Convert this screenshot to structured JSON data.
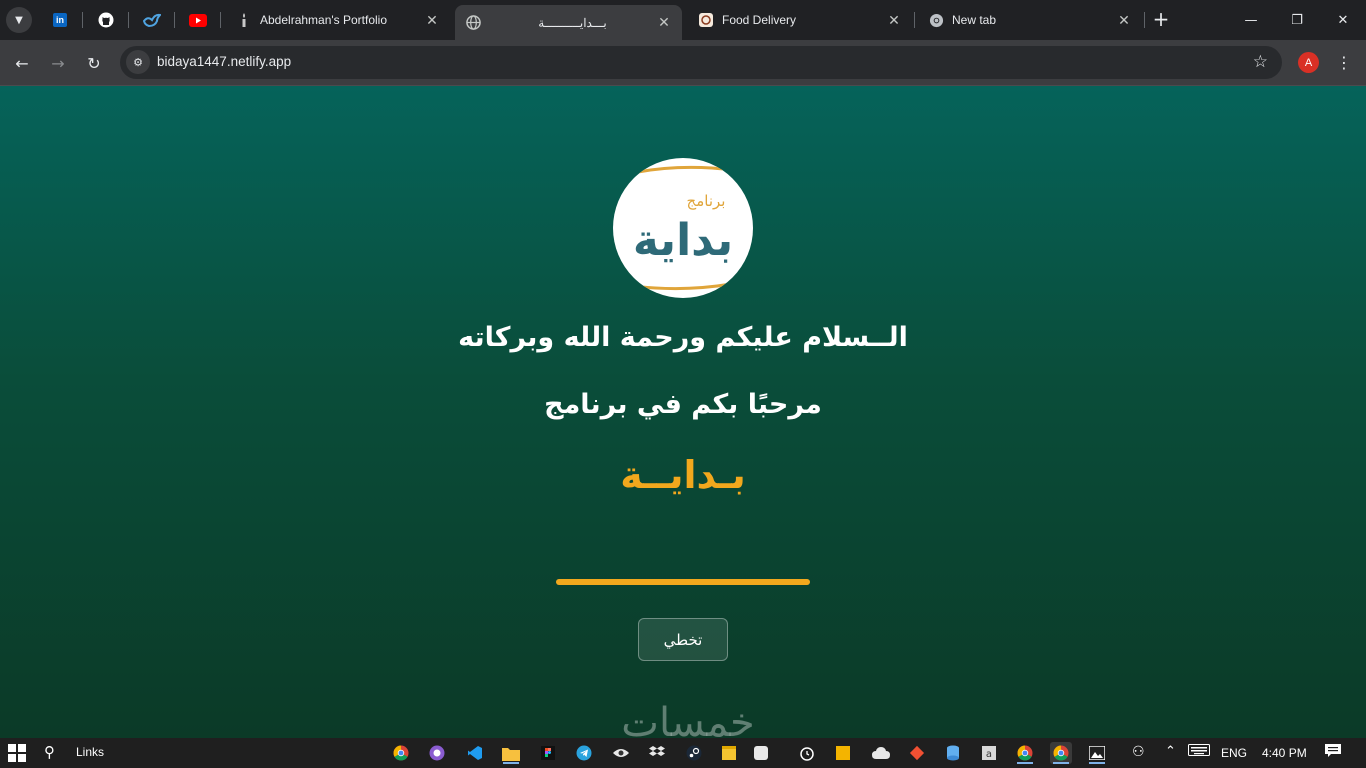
{
  "browser": {
    "pinned_tabs": [
      {
        "name": "linkedin-icon",
        "label": "in",
        "color": "#0a66c2"
      },
      {
        "name": "github-icon",
        "label": "",
        "color": "#ffffff"
      },
      {
        "name": "bird-icon",
        "label": "",
        "color": "#4fa3e0"
      },
      {
        "name": "youtube-icon",
        "label": "",
        "color": "#ff0000"
      }
    ],
    "tabs": [
      {
        "title": "Abdelrahman's Portfolio",
        "icon": "candle-icon",
        "active": false
      },
      {
        "title": "بـــدايــــــــــة",
        "icon": "globe-icon",
        "active": true
      },
      {
        "title": "Food Delivery",
        "icon": "food-icon",
        "active": false
      },
      {
        "title": "New tab",
        "icon": "chrome-icon",
        "active": false
      }
    ],
    "url": "bidaya1447.netlify.app",
    "profile_initial": "A"
  },
  "page": {
    "logo": {
      "small_text": "برنامج",
      "big_text": "بداية",
      "teal": "#2e6a78",
      "gold": "#e0a53a"
    },
    "greeting": "الــسلام عليكم ورحمة الله وبركاته",
    "welcome": "مرحبًا بكم في برنامج",
    "program_name": "بـدايــة",
    "progress_fraction": 1.0,
    "skip_label": "تخطي",
    "watermark": "خمسات",
    "accent_color": "#f2a81d"
  },
  "taskbar": {
    "search_toolbar_label": "Links",
    "apps": [
      "chrome-icon",
      "github-desktop-icon",
      "vscode-icon",
      "file-explorer-icon",
      "figma-icon",
      "telegram-icon",
      "eye-icon",
      "dropbox-icon",
      "steam-icon",
      "sticky-notes-icon",
      "alarm-icon",
      "git-icon",
      "db-icon",
      "app-icon",
      "chrome-icon",
      "chrome-icon",
      "photos-icon"
    ],
    "language": "ENG",
    "time": "4:40 PM"
  }
}
